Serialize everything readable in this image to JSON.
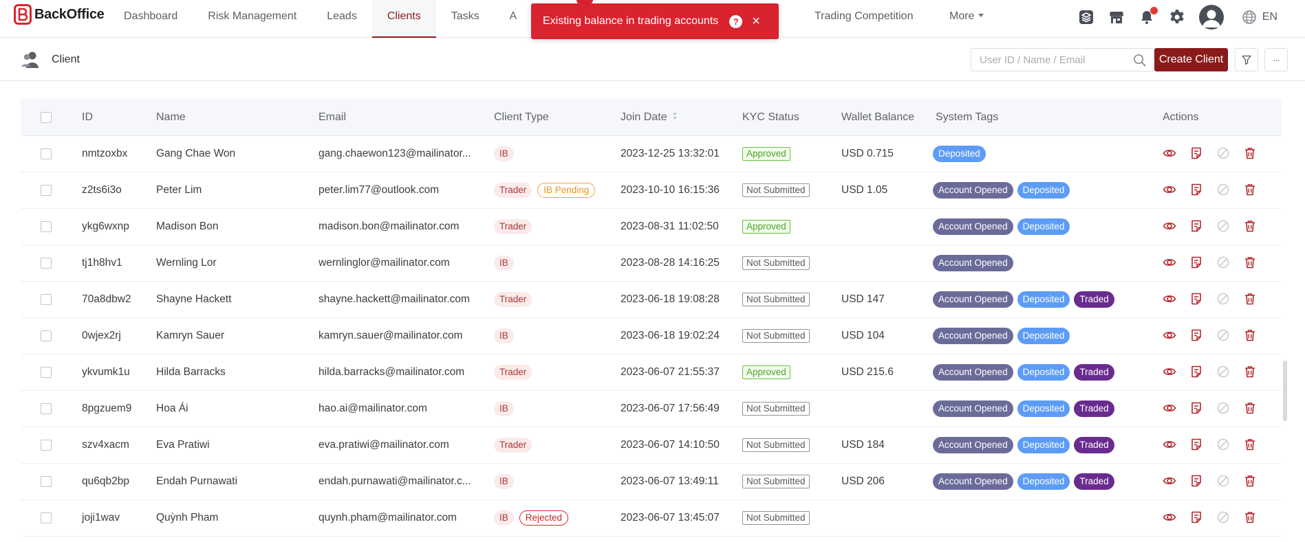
{
  "brand": {
    "name": "BackOffice",
    "color": "#d9232f"
  },
  "nav": {
    "items": [
      {
        "label": "Dashboard",
        "active": false
      },
      {
        "label": "Risk Management",
        "active": false
      },
      {
        "label": "Leads",
        "active": false
      },
      {
        "label": "Clients",
        "active": true
      },
      {
        "label": "Tasks",
        "active": false
      },
      {
        "label": "A",
        "active": false
      }
    ],
    "trading_competition": "Trading Competition",
    "more": "More"
  },
  "header_icons": [
    "stack-icon",
    "store-icon",
    "bell-icon",
    "gear-icon",
    "user-avatar",
    "globe-icon"
  ],
  "language": "EN",
  "toast": {
    "message": "Existing balance in trading accounts",
    "help": "?",
    "close": "×"
  },
  "page": {
    "title": "Client",
    "search_placeholder": "User ID / Name / Email",
    "create_label": "Create Client",
    "more_label": "···"
  },
  "table": {
    "columns": {
      "id": "ID",
      "name": "Name",
      "email": "Email",
      "client_type": "Client Type",
      "join_date": "Join Date",
      "kyc": "KYC Status",
      "wallet": "Wallet Balance",
      "tags": "System Tags",
      "actions": "Actions"
    },
    "rows": [
      {
        "id": "nmtzoxbx",
        "name": "Gang Chae Won",
        "email": "gang.chaewon123@mailinator...",
        "type": "IB",
        "extra": "",
        "join": "2023-12-25 13:32:01",
        "kyc": "Approved",
        "wallet": "USD 0.715",
        "tags": [
          "Deposited"
        ]
      },
      {
        "id": "z2ts6i3o",
        "name": "Peter Lim",
        "email": "peter.lim77@outlook.com",
        "type": "Trader",
        "extra": "IB Pending",
        "join": "2023-10-10 16:15:36",
        "kyc": "Not Submitted",
        "wallet": "USD 1.05",
        "tags": [
          "Account Opened",
          "Deposited"
        ]
      },
      {
        "id": "ykg6wxnp",
        "name": "Madison Bon",
        "email": "madison.bon@mailinator.com",
        "type": "Trader",
        "extra": "",
        "join": "2023-08-31 11:02:50",
        "kyc": "Approved",
        "wallet": "",
        "tags": [
          "Account Opened",
          "Deposited"
        ]
      },
      {
        "id": "tj1h8hv1",
        "name": "Wernling Lor",
        "email": "wernlinglor@mailinator.com",
        "type": "IB",
        "extra": "",
        "join": "2023-08-28 14:16:25",
        "kyc": "Not Submitted",
        "wallet": "",
        "tags": [
          "Account Opened"
        ]
      },
      {
        "id": "70a8dbw2",
        "name": "Shayne Hackett",
        "email": "shayne.hackett@mailinator.com",
        "type": "Trader",
        "extra": "",
        "join": "2023-06-18 19:08:28",
        "kyc": "Not Submitted",
        "wallet": "USD 147",
        "tags": [
          "Account Opened",
          "Deposited",
          "Traded"
        ]
      },
      {
        "id": "0wjex2rj",
        "name": "Kamryn Sauer",
        "email": "kamryn.sauer@mailinator.com",
        "type": "IB",
        "extra": "",
        "join": "2023-06-18 19:02:24",
        "kyc": "Not Submitted",
        "wallet": "USD 104",
        "tags": [
          "Account Opened",
          "Deposited"
        ]
      },
      {
        "id": "ykvumk1u",
        "name": "Hilda Barracks",
        "email": "hilda.barracks@mailinator.com",
        "type": "Trader",
        "extra": "",
        "join": "2023-06-07 21:55:37",
        "kyc": "Approved",
        "wallet": "USD 215.6",
        "tags": [
          "Account Opened",
          "Deposited",
          "Traded"
        ]
      },
      {
        "id": "8pgzuem9",
        "name": "Hoa Ái",
        "email": "hao.ai@mailinator.com",
        "type": "IB",
        "extra": "",
        "join": "2023-06-07 17:56:49",
        "kyc": "Not Submitted",
        "wallet": "",
        "tags": [
          "Account Opened",
          "Deposited",
          "Traded"
        ]
      },
      {
        "id": "szv4xacm",
        "name": "Eva Pratiwi",
        "email": "eva.pratiwi@mailinator.com",
        "type": "Trader",
        "extra": "",
        "join": "2023-06-07 14:10:50",
        "kyc": "Not Submitted",
        "wallet": "USD 184",
        "tags": [
          "Account Opened",
          "Deposited",
          "Traded"
        ]
      },
      {
        "id": "qu6qb2bp",
        "name": "Endah Purnawati",
        "email": "endah.purnawati@mailinator.c...",
        "type": "IB",
        "extra": "",
        "join": "2023-06-07 13:49:11",
        "kyc": "Not Submitted",
        "wallet": "USD 206",
        "tags": [
          "Account Opened",
          "Deposited",
          "Traded"
        ]
      },
      {
        "id": "joji1wav",
        "name": "Quỳnh Pham",
        "email": "quynh.pham@mailinator.com",
        "type": "IB",
        "extra": "Rejected",
        "join": "2023-06-07 13:45:07",
        "kyc": "Not Submitted",
        "wallet": "",
        "tags": []
      }
    ]
  },
  "colors": {
    "accent": "#8b1a1a",
    "toast": "#d9232f",
    "tag_account_opened": "#6b6b9a",
    "tag_deposited": "#5c9cf5",
    "tag_traded": "#6a2b8f",
    "kyc_approved": "#67c23a"
  }
}
